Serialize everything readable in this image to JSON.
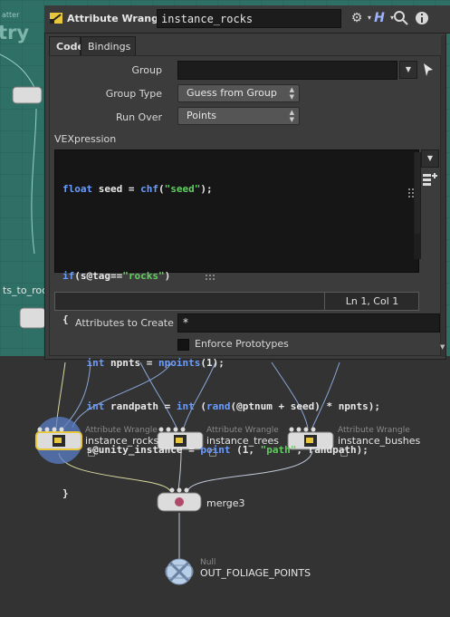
{
  "background": {
    "fragment_top": "atter",
    "fragment_try": "try",
    "fragment_left": "ts_to_rock",
    "nodes": [
      {
        "type_label": "Attribute Wrangle",
        "name": "instance_rocks"
      },
      {
        "type_label": "Attribute Wrangle",
        "name": "instance_trees"
      },
      {
        "type_label": "Attribute Wrangle",
        "name": "instance_bushes"
      },
      {
        "type_label": "",
        "name": "merge3"
      },
      {
        "type_label": "Null",
        "name": "OUT_FOLIAGE_POINTS"
      }
    ]
  },
  "titlebar": {
    "node_type": "Attribute Wrangle",
    "node_name": "instance_rocks",
    "icons": [
      "gear-icon",
      "help-icon",
      "search-icon",
      "info-icon"
    ]
  },
  "tabs": [
    {
      "label": "Code",
      "active": true
    },
    {
      "label": "Bindings",
      "active": false
    }
  ],
  "params": {
    "group_label": "Group",
    "group_value": "",
    "group_type_label": "Group Type",
    "group_type_value": "Guess from Group",
    "run_over_label": "Run Over",
    "run_over_value": "Points",
    "vex_label": "VEXpression",
    "cursor_position": "Ln 1, Col 1",
    "attributes_label": "Attributes to Create",
    "attributes_value": "*",
    "enforce_prototypes_label": "Enforce Prototypes",
    "enforce_prototypes_checked": false
  },
  "code": {
    "l1_kw": "float",
    "l1_mid": " seed = ",
    "l1_fn": "chf",
    "l1_pre": "(",
    "l1_str": "\"seed\"",
    "l1_post": ");",
    "l3_kw": "if",
    "l3_mid": "(s@tag==",
    "l3_str": "\"rocks\"",
    "l3_post": ")",
    "l4": "{",
    "l5_kw": "int",
    "l5_mid": " npnts = ",
    "l5_fn": "npoints",
    "l5_post": "(1);",
    "l6_kw": "int",
    "l6_mid": " randpath = ",
    "l6_kw2": "int",
    "l6_sp": " (",
    "l6_fn": "rand",
    "l6_post": "(@ptnum + seed) * npnts);",
    "l7_pre": "s@unity_instance = ",
    "l7_fn": "point",
    "l7_mid": " (1, ",
    "l7_str": "\"path\"",
    "l7_post": ", randpath);",
    "l8": "}"
  },
  "colors": {
    "network_top": "#2e6f66",
    "keyword": "#6b9cff",
    "string": "#5fce5f",
    "selected_node": "#e8c83a"
  }
}
